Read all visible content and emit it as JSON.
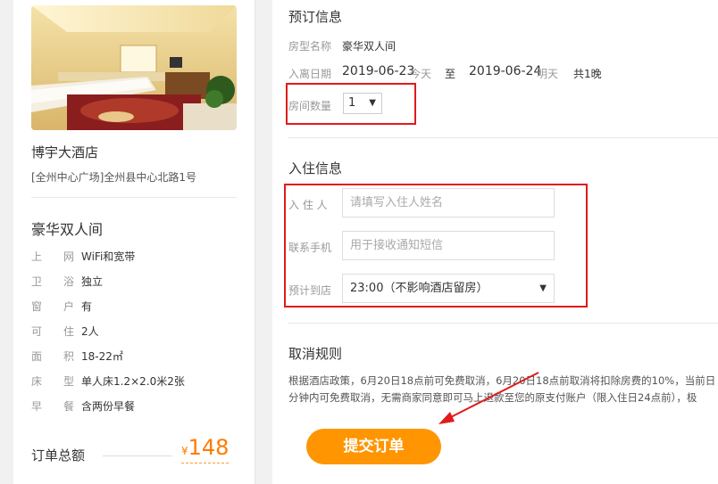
{
  "hotel": {
    "name": "博宇大酒店",
    "address": "[全州中心广场]全州县中心北路1号"
  },
  "room": {
    "name": "豪华双人间",
    "amenities": [
      {
        "key": "上　　网",
        "value": "WiFi和宽带"
      },
      {
        "key": "卫　　浴",
        "value": "独立"
      },
      {
        "key": "窗　　户",
        "value": "有"
      },
      {
        "key": "可　　住",
        "value": "2人"
      },
      {
        "key": "面　　积",
        "value": "18-22㎡"
      },
      {
        "key": "床　　型",
        "value": "单人床1.2×2.0米2张"
      },
      {
        "key": "早　　餐",
        "value": "含两份早餐"
      }
    ]
  },
  "total": {
    "label": "订单总额",
    "currency": "¥",
    "amount": "148"
  },
  "booking": {
    "title": "预订信息",
    "room_type_label": "房型名称",
    "room_type_value": "豪华双人间",
    "dates_label": "入离日期",
    "checkin_date": "2019-06-23",
    "checkin_day": "今天",
    "to": "至",
    "checkout_date": "2019-06-24",
    "checkout_day": "明天",
    "nights": "共1晚",
    "room_count_label": "房间数量",
    "room_count_value": "1"
  },
  "guest": {
    "title": "入住信息",
    "name_label": "入 住 人",
    "name_placeholder": "请填写入住人姓名",
    "phone_label": "联系手机",
    "phone_placeholder": "用于接收通知短信",
    "arrival_label": "预计到店",
    "arrival_value": "23:00（不影响酒店留房）"
  },
  "cancel": {
    "title": "取消规则",
    "line1": "根据酒店政策，6月20日18点前可免费取消，6月20日18点前取消将扣除房费的10%，当前日",
    "line2": "分钟内可免费取消，无需商家同意即可马上退款至您的原支付账户（限入住日24点前），极"
  },
  "submit_label": "提交订单",
  "colors": {
    "accent": "#ff9500",
    "price": "#ff7a00",
    "highlight_box": "#e01b1b"
  }
}
